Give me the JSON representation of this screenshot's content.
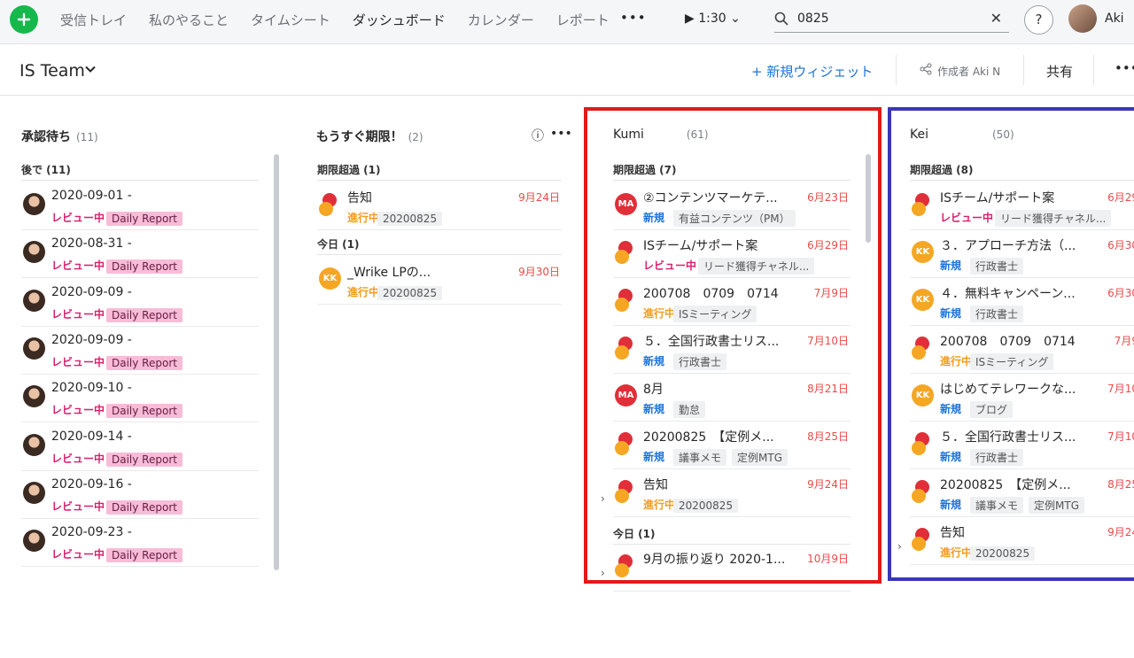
{
  "topbar": {
    "nav": [
      "受信トレイ",
      "私のやること",
      "タイムシート",
      "ダッシュボード",
      "カレンダー",
      "レポート"
    ],
    "more": "•••",
    "timer": "▶ 1:30 ⌄",
    "search_value": "0825",
    "clear": "✕",
    "help": "?",
    "user_name": "Aki"
  },
  "header": {
    "team_name": "IS Team",
    "new_widget": "+ 新規ウィジェット",
    "creator": "作成者 Aki N",
    "share": "共有",
    "more": "•••"
  },
  "card1": {
    "title": "承認待ち",
    "count": "(11)",
    "section": "後で (11)",
    "rows": [
      {
        "title": "2020-09-01 - ",
        "status": "レビュー中",
        "tag": "Daily Report"
      },
      {
        "title": "2020-08-31 - ",
        "status": "レビュー中",
        "tag": "Daily Report"
      },
      {
        "title": "2020-09-09 - ",
        "status": "レビュー中",
        "tag": "Daily Report"
      },
      {
        "title": "2020-09-09 - ",
        "status": "レビュー中",
        "tag": "Daily Report"
      },
      {
        "title": "2020-09-10 - ",
        "status": "レビュー中",
        "tag": "Daily Report"
      },
      {
        "title": "2020-09-14 - ",
        "status": "レビュー中",
        "tag": "Daily Report"
      },
      {
        "title": "2020-09-16 - ",
        "status": "レビュー中",
        "tag": "Daily Report"
      },
      {
        "title": "2020-09-23 - ",
        "status": "レビュー中",
        "tag": "Daily Report"
      }
    ]
  },
  "card2": {
    "title": "もうすぐ期限！",
    "count": "(2)",
    "section1": "期限超過 (1)",
    "section2": "今日 (1)",
    "rows": [
      {
        "title": "告知",
        "date": "9月24日",
        "status": "進行中",
        "tag": "20200825"
      },
      {
        "title": "_Wrike LPの...",
        "date": "9月30日",
        "status": "進行中",
        "tag": "20200825",
        "avatar": "KK"
      }
    ]
  },
  "card3": {
    "title": "Kumi",
    "count": "(61)",
    "section1": "期限超過 (7)",
    "section2": "今日 (1)",
    "rows": [
      {
        "title": "②コンテンツマーケテ...",
        "date": "6月23日",
        "status": "新規",
        "tag": "有益コンテンツ（PM）",
        "avatar": "MA"
      },
      {
        "title": "ISチーム/サポート案",
        "date": "6月29日",
        "status": "レビュー中",
        "tag": "リード獲得チャネル..."
      },
      {
        "title": "200708　0709　0714　...",
        "date": "7月9日",
        "status": "進行中",
        "tag": "ISミーティング"
      },
      {
        "title": "５．全国行政書士リス...",
        "date": "7月10日",
        "status": "新規",
        "tag": "行政書士"
      },
      {
        "title": "8月",
        "date": "8月21日",
        "status": "新規",
        "tag": "勤怠",
        "avatar": "MA"
      },
      {
        "title": "20200825　【定例メ...",
        "date": "8月25日",
        "status": "新規",
        "tag": "議事メモ",
        "tag2": "定例MTG"
      },
      {
        "title": "告知",
        "date": "9月24日",
        "status": "進行中",
        "tag": "20200825"
      },
      {
        "title": "9月の振り返り 2020-1...",
        "date": "10月9日"
      }
    ]
  },
  "card4": {
    "title": "Kei",
    "count": "(50)",
    "section1": "期限超過 (8)",
    "rows": [
      {
        "title": "ISチーム/サポート案",
        "date": "6月29",
        "status": "レビュー中",
        "tag": "リード獲得チャネル..."
      },
      {
        "title": "３．アプローチ方法（...",
        "date": "6月30",
        "status": "新規",
        "tag": "行政書士",
        "avatar": "KK"
      },
      {
        "title": "４．無料キャンペーン...",
        "date": "6月30",
        "status": "新規",
        "tag": "行政書士",
        "avatar": "KK"
      },
      {
        "title": "200708　0709　0714　...",
        "date": "7月9",
        "status": "進行中",
        "tag": "ISミーティング"
      },
      {
        "title": "はじめてテレワークな...",
        "date": "7月10",
        "status": "新規",
        "tag": "ブログ",
        "avatar": "KK"
      },
      {
        "title": "５．全国行政書士リス...",
        "date": "7月10",
        "status": "新規",
        "tag": "行政書士"
      },
      {
        "title": "20200825　【定例メ...",
        "date": "8月25",
        "status": "新規",
        "tag": "議事メモ",
        "tag2": "定例MTG"
      },
      {
        "title": "告知",
        "date": "9月24",
        "status": "進行中",
        "tag": "20200825"
      }
    ]
  },
  "colors": {
    "review": "#d81f6e",
    "progress": "#f29a1a",
    "new": "#1a73d9",
    "overdue": "#e84b4b",
    "highlight_red": "#e11a1a",
    "highlight_blue": "#3b36b8"
  }
}
